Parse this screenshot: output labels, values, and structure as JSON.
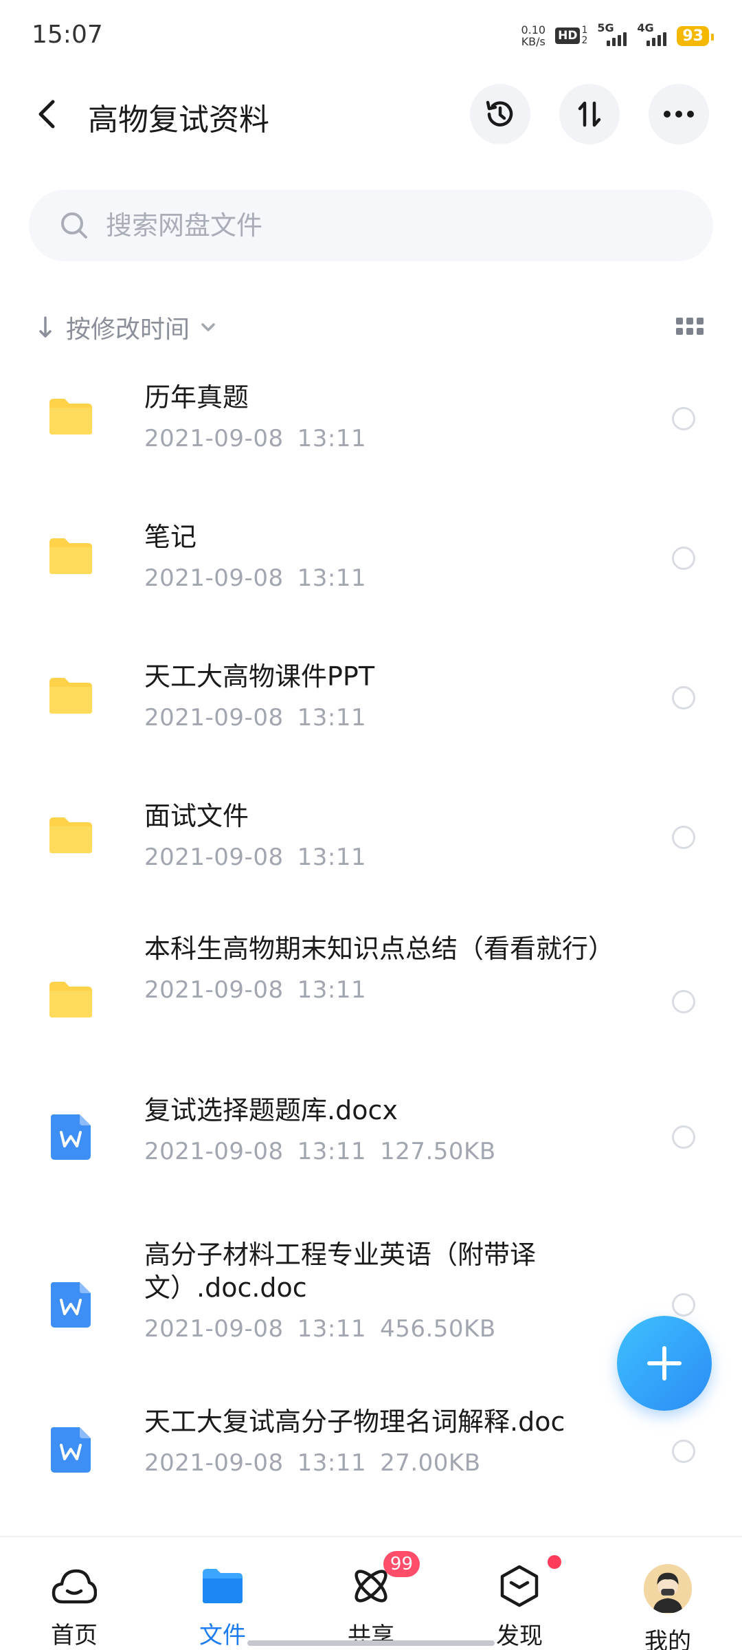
{
  "status_bar": {
    "time": "15:07",
    "net_speed_value": "0.10",
    "net_speed_unit": "KB/s",
    "hd_label": "HD",
    "hd_sim1": "1",
    "hd_sim2": "2",
    "signal1_label": "5G",
    "signal2_label": "4G",
    "battery": "93"
  },
  "header": {
    "title": "高物复试资料",
    "icons": [
      "back-icon",
      "history-icon",
      "sort-transfer-icon",
      "more-icon"
    ]
  },
  "search": {
    "placeholder": "搜索网盘文件"
  },
  "sort": {
    "label": "按修改时间"
  },
  "files": [
    {
      "type": "folder",
      "name": "历年真题",
      "date": "2021-09-08",
      "time": "13:11",
      "size": ""
    },
    {
      "type": "folder",
      "name": "笔记",
      "date": "2021-09-08",
      "time": "13:11",
      "size": ""
    },
    {
      "type": "folder",
      "name": "天工大高物课件PPT",
      "date": "2021-09-08",
      "time": "13:11",
      "size": ""
    },
    {
      "type": "folder",
      "name": "面试文件",
      "date": "2021-09-08",
      "time": "13:11",
      "size": ""
    },
    {
      "type": "folder",
      "name": "本科生高物期末知识点总结（看看就行）",
      "date": "2021-09-08",
      "time": "13:11",
      "size": ""
    },
    {
      "type": "doc",
      "name": "复试选择题题库.docx",
      "date": "2021-09-08",
      "time": "13:11",
      "size": "127.50KB"
    },
    {
      "type": "doc",
      "name": "高分子材料工程专业英语（附带译文）.doc.doc",
      "date": "2021-09-08",
      "time": "13:11",
      "size": "456.50KB"
    },
    {
      "type": "doc",
      "name": "天工大复试高分子物理名词解释.doc",
      "date": "2021-09-08",
      "time": "13:11",
      "size": "27.00KB"
    }
  ],
  "bottom_nav": {
    "items": [
      {
        "label": "首页",
        "icon": "cloud-home-icon"
      },
      {
        "label": "文件",
        "icon": "folder-icon",
        "active": true
      },
      {
        "label": "共享",
        "icon": "atom-share-icon",
        "badge": "99"
      },
      {
        "label": "发现",
        "icon": "cube-discover-icon"
      },
      {
        "label": "我的",
        "icon": "avatar"
      }
    ]
  },
  "colors": {
    "accent": "#1e7cf2",
    "folder": "#ffd24a",
    "doc": "#3d8ff5",
    "badge": "#ff4d6a"
  }
}
